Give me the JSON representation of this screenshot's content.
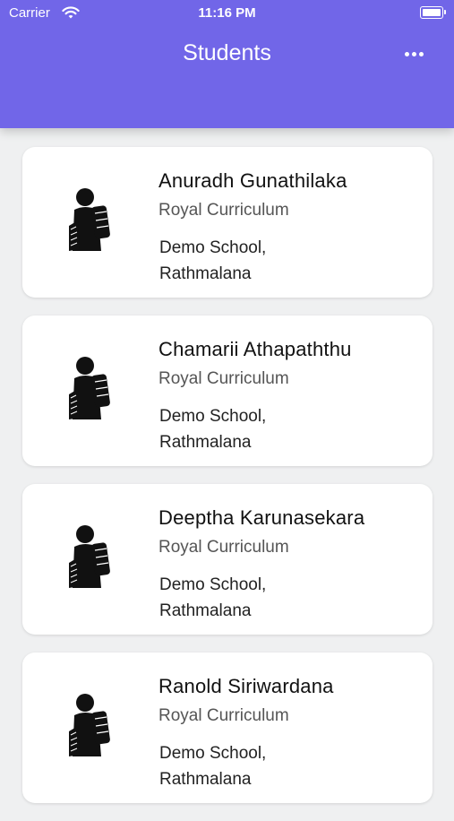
{
  "status_bar": {
    "carrier": "Carrier",
    "time": "11:16 PM"
  },
  "header": {
    "title": "Students",
    "menu_icon": "more-horizontal-icon"
  },
  "colors": {
    "header_bg": "#7166e8",
    "page_bg": "#eff0f1"
  },
  "students": [
    {
      "name": "Anuradh Gunathilaka",
      "curriculum": "Royal Curriculum",
      "school_line1": "Demo School,",
      "school_line2": "Rathmalana",
      "icon": "student-icon"
    },
    {
      "name": "Chamarii Athapaththu",
      "curriculum": "Royal Curriculum",
      "school_line1": "Demo School,",
      "school_line2": "Rathmalana",
      "icon": "student-icon"
    },
    {
      "name": "Deeptha Karunasekara",
      "curriculum": "Royal Curriculum",
      "school_line1": "Demo School,",
      "school_line2": "Rathmalana",
      "icon": "student-icon"
    },
    {
      "name": "Ranold Siriwardana",
      "curriculum": "Royal Curriculum",
      "school_line1": "Demo School,",
      "school_line2": "Rathmalana",
      "icon": "student-icon"
    }
  ]
}
